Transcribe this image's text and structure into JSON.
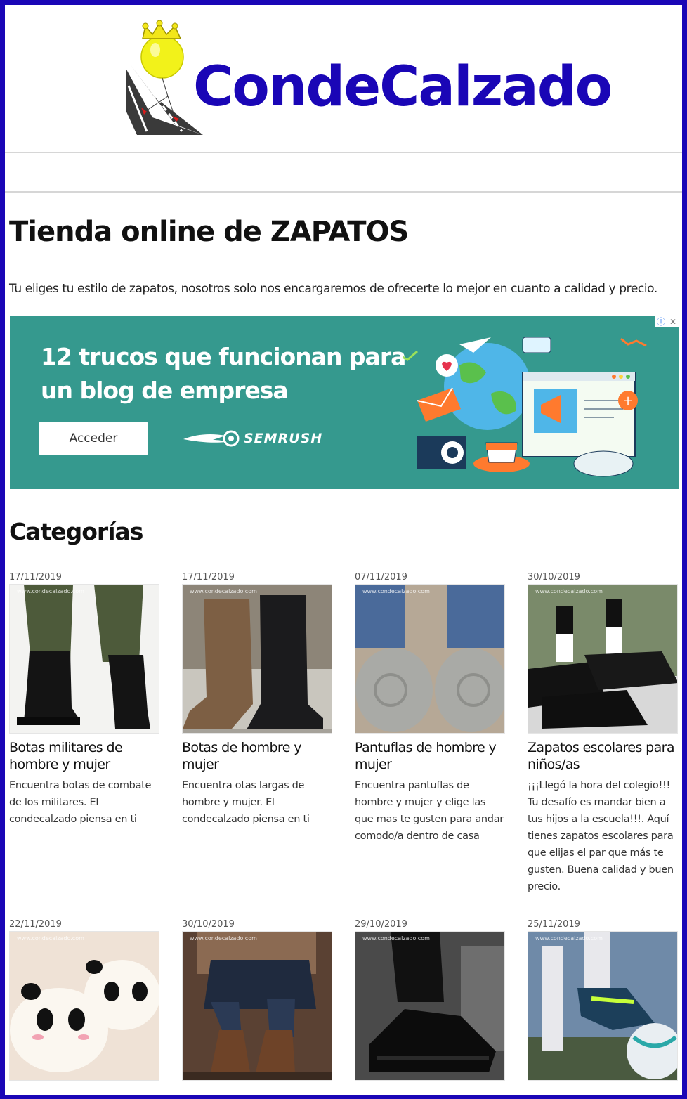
{
  "logo": {
    "text": "CondeCalzado"
  },
  "page": {
    "title": "Tienda online de ZAPATOS",
    "intro": "Tu eliges tu estilo de zapatos, nosotros solo nos encargaremos de ofrecerte lo mejor en cuanto a calidad y precio."
  },
  "ad": {
    "headline": "12 trucos que funcionan para un blog de empresa",
    "button": "Acceder",
    "brand": "SEMRUSH",
    "info_icon": "info-icon",
    "close_icon": "close-icon",
    "background": "#35998e"
  },
  "categories": {
    "title": "Categorías",
    "items": [
      {
        "date": "17/11/2019",
        "title": "Botas militares de hombre y mujer",
        "excerpt": "Encuentra botas de combate de los militares. El condecalzado piensa en ti",
        "watermark": "www.condecalzado.com"
      },
      {
        "date": "17/11/2019",
        "title": "Botas de hombre y mujer",
        "excerpt": "Encuentra otas largas de hombre y mujer. El condecalzado piensa en ti",
        "watermark": "www.condecalzado.com"
      },
      {
        "date": "07/11/2019",
        "title": "Pantuflas de hombre y mujer",
        "excerpt": "Encuentra pantuflas de hombre y mujer y elige las que mas te gusten para andar comodo/a dentro de casa",
        "watermark": "www.condecalzado.com"
      },
      {
        "date": "30/10/2019",
        "title": "Zapatos escolares para niños/as",
        "excerpt": "¡¡¡Llegó la hora del colegio!!! Tu desafío es mandar bien a tus hijos a la escuela!!!. Aquí tienes zapatos escolares para que elijas el par que más te gusten. Buena calidad y buen precio.",
        "watermark": "www.condecalzado.com"
      },
      {
        "date": "22/11/2019",
        "title": "",
        "excerpt": "",
        "watermark": "www.condecalzado.com"
      },
      {
        "date": "30/10/2019",
        "title": "",
        "excerpt": "",
        "watermark": "www.condecalzado.com"
      },
      {
        "date": "29/10/2019",
        "title": "",
        "excerpt": "",
        "watermark": "www.condecalzado.com"
      },
      {
        "date": "25/11/2019",
        "title": "",
        "excerpt": "",
        "watermark": "www.condecalzado.com"
      }
    ]
  }
}
